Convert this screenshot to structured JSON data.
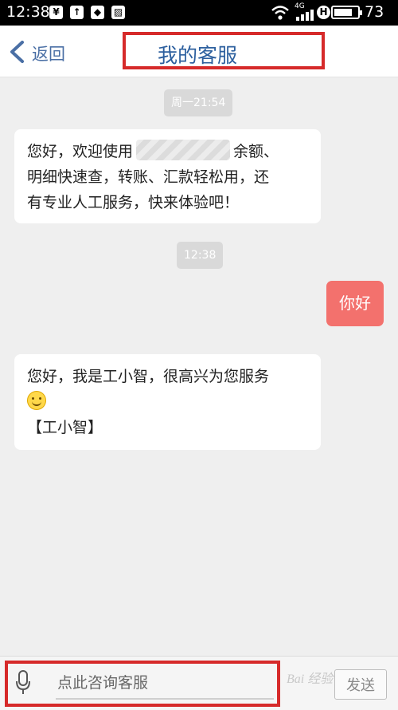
{
  "status_bar": {
    "time": "12:38",
    "battery_percent": "73",
    "network_label": "4G",
    "icons": [
      "yen-icon",
      "upload-icon",
      "notification-icon",
      "image-icon",
      "wifi-icon",
      "signal-icon",
      "hd-icon",
      "battery-icon"
    ]
  },
  "header": {
    "back_label": "返回",
    "title": "我的客服"
  },
  "messages": [
    {
      "type": "time",
      "text": "周一21:54"
    },
    {
      "type": "incoming",
      "line1_a": "您好，欢迎使用",
      "line1_b": "余额、",
      "line2": "明细快速查，转账、汇款轻松用，还",
      "line3": "有专业人工服务，快来体验吧！"
    },
    {
      "type": "time",
      "text": "12:38"
    },
    {
      "type": "outgoing",
      "text": "你好"
    },
    {
      "type": "incoming",
      "line1": "您好，我是工小智，很高兴为您服务",
      "line3": "【工小智】"
    }
  ],
  "input_bar": {
    "placeholder": "点此咨询客服",
    "send_label": "发送",
    "watermark": "Bai 经验"
  },
  "colors": {
    "accent_red": "#d62a2a",
    "outgoing_bubble": "#f3716d",
    "title_blue": "#2c5f9e"
  }
}
